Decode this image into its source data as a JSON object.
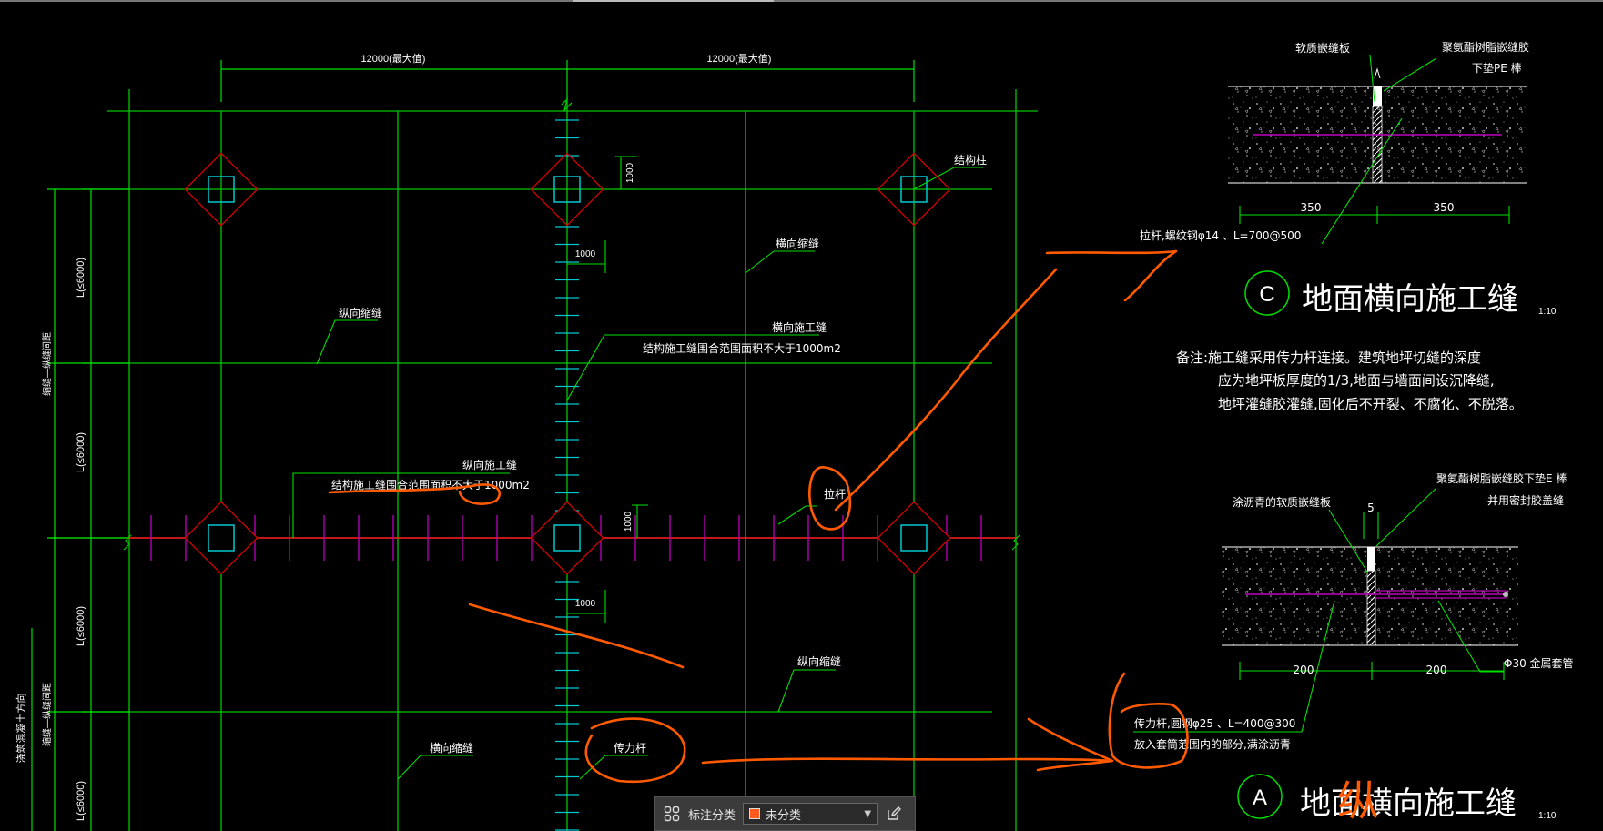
{
  "colors": {
    "grid_line": "#00c800",
    "dimension": "#00e000",
    "column_square": "#00c8d2",
    "column_diamond": "#d20000",
    "dowel": "#c000c0",
    "red_line": "#ff2020",
    "text": "#ffffff",
    "markup": "#ff5a00",
    "annotation_swatch": "#ff5a1e"
  },
  "plan": {
    "top_dims": [
      "12000(最大值)",
      "12000(最大值)"
    ],
    "left_dims": [
      "L(≤6000)",
      "L(≤6000)",
      "L(≤6000)",
      "L(≤6000)"
    ],
    "left_side_labels": [
      "缩缝—纵缝间距",
      "缩缝—纵缝间距"
    ],
    "paving_direction": "浇筑混凝土方向",
    "small_dims": [
      "1000",
      "1000",
      "1000",
      "1000"
    ],
    "labels": {
      "column": "结构柱",
      "transverse_shrinkage": "横向缩缝",
      "longitudinal_shrinkage": "纵向缩缝",
      "transverse_construction": "横向施工缝",
      "area_note": "结构施工缝围合范围面积不大于1000m2",
      "longitudinal_construction": "纵向施工缝",
      "tie_bar": "拉杆",
      "longitudinal_shrinkage_2": "纵向缩缝",
      "transverse_shrinkage_2": "横向缩缝",
      "dowel_bar": "传力杆"
    }
  },
  "detail_c": {
    "label_board": "软质嵌缝板",
    "label_sealant": "聚氨酯树脂嵌缝胶",
    "label_pe": "下垫PE 棒",
    "dim_left": "350",
    "dim_right": "350",
    "tie_note": "拉杆,螺纹钢φ14 、L=700@500",
    "letter": "C",
    "title": "地面横向施工缝",
    "scale": "1:10"
  },
  "notes": [
    "备注:施工缝采用传力杆连接。建筑地坪切缝的深度",
    "应为地坪板厚度的1/3,地面与墙面间设沉降缝,",
    "地坪灌缝胶灌缝,固化后不开裂、不腐化、不脱落。"
  ],
  "detail_a": {
    "label_board": "涂沥青的软质嵌缝板",
    "dim_5": "5",
    "label_sealant": "聚氨酯树脂嵌缝胶下垫E 棒",
    "label_sealant2": "并用密封胶盖缝",
    "dim_left": "200",
    "dim_right": "200",
    "sleeve": "Φ30 金属套管",
    "dowel_note1": "传力杆,圆钢φ25 、L=400@300",
    "dowel_note2": "放入套筒范围内的部分,满涂沥青",
    "letter": "A",
    "title": "地面横向施工缝",
    "scale": "1:10",
    "handwritten": "纵"
  },
  "annotation_bar": {
    "label": "标注分类",
    "selected": "未分类"
  }
}
